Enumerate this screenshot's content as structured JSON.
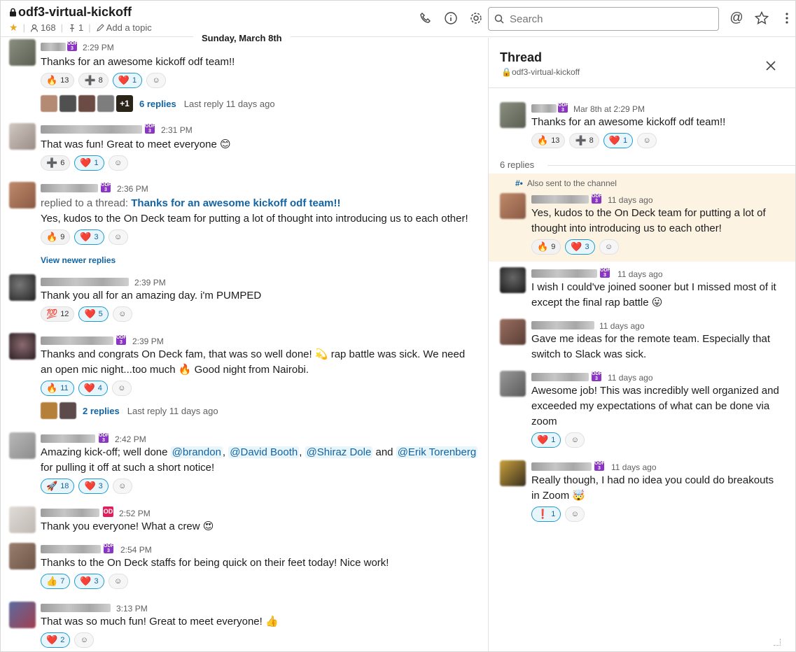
{
  "channel": {
    "name": "odf3-virtual-kickoff",
    "members": "168",
    "pins": "1",
    "add_topic": "Add a topic"
  },
  "search": {
    "placeholder": "Search"
  },
  "date_divider": "Sunday, March 8th",
  "channel_messages": [
    {
      "time": "2:29 PM",
      "text": "Thanks for an awesome kickoff odf team!!",
      "badge": "ODF 3",
      "reactions": [
        {
          "emoji": "🔥",
          "count": "13"
        },
        {
          "emoji": "➕",
          "count": "8"
        },
        {
          "emoji": "❤️",
          "count": "1",
          "mine": true
        }
      ],
      "replies": {
        "label": "6 replies",
        "last": "Last reply 11 days ago",
        "extra": "+1"
      }
    },
    {
      "time": "2:31 PM",
      "text": "That was fun! Great to meet everyone 😊",
      "badge": "ODF 3",
      "reactions": [
        {
          "emoji": "➕",
          "count": "6"
        },
        {
          "emoji": "❤️",
          "count": "1",
          "mine": true
        }
      ]
    },
    {
      "time": "2:36 PM",
      "prefix": "replied to a thread:",
      "link": "Thanks for an awesome kickoff odf team!!",
      "text": "Yes, kudos to the On Deck team for putting a lot of thought into introducing us to each other!",
      "badge": "ODF 3",
      "reactions": [
        {
          "emoji": "🔥",
          "count": "9"
        },
        {
          "emoji": "❤️",
          "count": "3",
          "mine": true
        }
      ],
      "view_newer": "View newer replies"
    },
    {
      "time": "2:39 PM",
      "text": "Thank you all for an amazing day. i'm PUMPED",
      "reactions": [
        {
          "emoji": "💯",
          "count": "12"
        },
        {
          "emoji": "❤️",
          "count": "5",
          "mine": true
        }
      ]
    },
    {
      "time": "2:39 PM",
      "text": "Thanks and congrats On Deck fam, that was so well done! 💫 rap battle was sick. We need an open mic night...too much 🔥 Good night from Nairobi.",
      "badge": "ODF 3",
      "reactions": [
        {
          "emoji": "🔥",
          "count": "11",
          "mine": true
        },
        {
          "emoji": "❤️",
          "count": "4",
          "mine": true
        }
      ],
      "replies": {
        "label": "2 replies",
        "last": "Last reply 11 days ago"
      }
    },
    {
      "time": "2:42 PM",
      "text_parts": [
        "Amazing kick-off; well done ",
        "@brandon",
        ", ",
        "@David Booth",
        ", ",
        "@Shiraz Dole",
        " and ",
        "@Erik Torenberg",
        " for pulling it off at such a short notice!"
      ],
      "badge": "ODF 3",
      "reactions": [
        {
          "emoji": "🚀",
          "count": "18",
          "mine": true
        },
        {
          "emoji": "❤️",
          "count": "3",
          "mine": true
        }
      ]
    },
    {
      "time": "2:52 PM",
      "text": "Thank you everyone! What a crew 😍",
      "badge": "OD"
    },
    {
      "time": "2:54 PM",
      "text": "Thanks to the On Deck staffs for being quick on their feet today! Nice work!",
      "badge": "ODF 3",
      "reactions": [
        {
          "emoji": "👍",
          "count": "7",
          "mine": true
        },
        {
          "emoji": "❤️",
          "count": "3",
          "mine": true
        }
      ]
    },
    {
      "time": "3:13 PM",
      "text": "That was so much fun! Great to meet everyone! 👍",
      "reactions": [
        {
          "emoji": "❤️",
          "count": "2",
          "mine": true
        }
      ]
    }
  ],
  "thread": {
    "title": "Thread",
    "channel": "odf3-virtual-kickoff",
    "reply_count": "6 replies",
    "also_sent": "Also sent to the channel",
    "parent": {
      "time": "Mar 8th at 2:29 PM",
      "text": "Thanks for an awesome kickoff odf team!!",
      "reactions": [
        {
          "emoji": "🔥",
          "count": "13"
        },
        {
          "emoji": "➕",
          "count": "8"
        },
        {
          "emoji": "❤️",
          "count": "1",
          "mine": true
        }
      ]
    },
    "replies": [
      {
        "time": "11 days ago",
        "text": "Yes, kudos to the On Deck team for putting a lot of thought into introducing us to each other!",
        "reactions": [
          {
            "emoji": "🔥",
            "count": "9"
          },
          {
            "emoji": "❤️",
            "count": "3",
            "mine": true
          }
        ]
      },
      {
        "time": "11 days ago",
        "text": "I wish I could've joined sooner but I missed most of it except the final rap battle 😛"
      },
      {
        "time": "11 days ago",
        "text": "Gave me ideas for the remote team. Especially that switch to Slack was sick."
      },
      {
        "time": "11 days ago",
        "text": "Awesome job! This was incredibly well organized and exceeded my expectations of what can be done via zoom",
        "reactions": [
          {
            "emoji": "❤️",
            "count": "1",
            "mine": true
          }
        ]
      },
      {
        "time": "11 days ago",
        "text": "Really though, I had no idea you could do breakouts in Zoom 🤯",
        "reactions": [
          {
            "emoji": "❗",
            "count": "1",
            "mine": true
          }
        ]
      }
    ]
  },
  "colors": {
    "accent": "#1264a3",
    "badge": "#8a35c4",
    "highlight": "#fcf3e3"
  }
}
